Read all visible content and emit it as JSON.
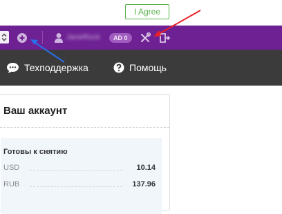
{
  "agree_button": {
    "label": "I Agree"
  },
  "topbar": {
    "username": "JaneRock",
    "ad_badge": "AD 0"
  },
  "navbar": {
    "support_label": "Техподдержка",
    "help_label": "Помощь"
  },
  "account": {
    "title": "Ваш аккаунт",
    "balance_heading": "Готовы к снятию",
    "rows": [
      {
        "currency": "USD",
        "amount": "10.14"
      },
      {
        "currency": "RUB",
        "amount": "137.96"
      }
    ]
  },
  "colors": {
    "topbar": "#6d2193",
    "navbar": "#3b3b3b",
    "agree_green": "#58b14a",
    "red_arrow": "#e8202a",
    "blue_arrow": "#2a6ee8"
  }
}
